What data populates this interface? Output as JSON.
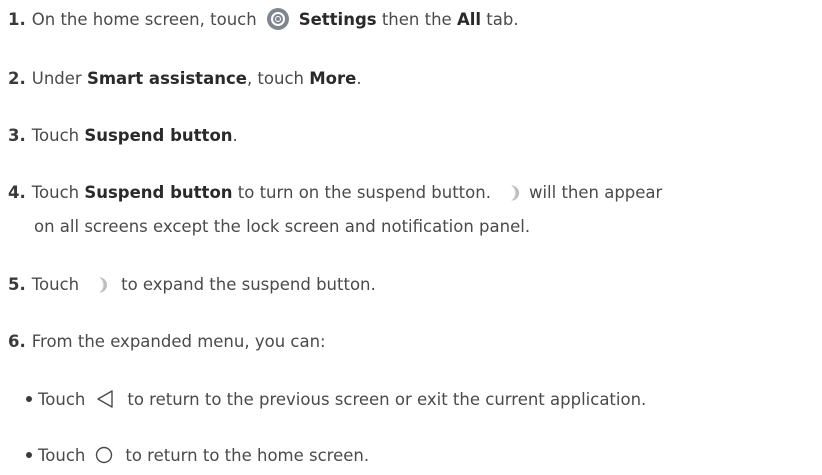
{
  "steps": [
    {
      "num": "1.",
      "parts": [
        "On the home screen, touch",
        "Settings",
        "then the",
        "All",
        "tab."
      ]
    },
    {
      "num": "2.",
      "parts": [
        "Under",
        "Smart assistance",
        ", touch",
        "More",
        "."
      ]
    },
    {
      "num": "3.",
      "parts": [
        "Touch",
        "Suspend button",
        "."
      ]
    },
    {
      "num": "4.",
      "parts": [
        "Touch",
        "Suspend button",
        "to turn on the suspend button.",
        "will then appear"
      ],
      "continuation": "on all screens except the lock screen and notification panel."
    },
    {
      "num": "5.",
      "parts": [
        "Touch",
        "to expand the suspend button."
      ]
    },
    {
      "num": "6.",
      "parts": [
        "From the expanded menu, you can:"
      ]
    }
  ],
  "bullets": [
    {
      "prefix": "Touch",
      "text": "to return to the previous screen or exit the current application."
    },
    {
      "prefix": "Touch",
      "text": "to return to the home screen."
    }
  ],
  "icons": {
    "settings": "settings-gear-icon",
    "suspend": "suspend-button-icon",
    "back": "back-triangle-icon",
    "home": "home-circle-icon"
  },
  "colors": {
    "text": "#4a4a4a",
    "bold": "#2a2a2a",
    "settings_icon": "#7e8790",
    "suspend_icon": "#c9c9c9"
  }
}
